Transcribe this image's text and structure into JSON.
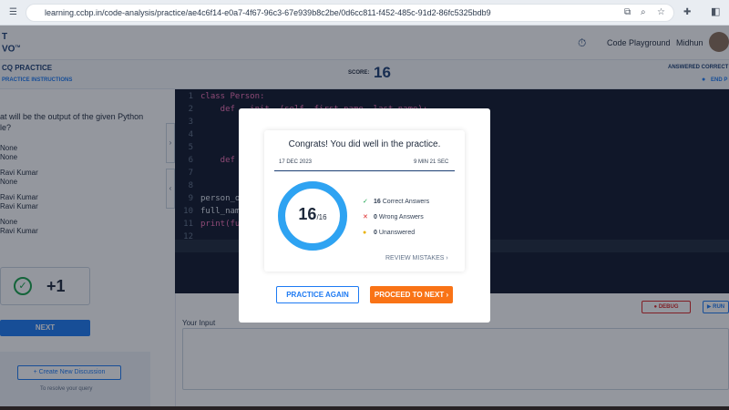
{
  "browser": {
    "url": "learning.ccbp.in/code-analysis/practice/ae4c6f14-e0a7-4f67-96c3-67e939b8c2be/0d6cc811-f452-485c-91d2-86fc5325bdb9"
  },
  "header": {
    "logo_line1": "T",
    "logo_line2": "VO",
    "logo_tm": "TM",
    "code_playground": "Code Playground",
    "user_name": "Midhun"
  },
  "subheader": {
    "title": "CQ PRACTICE",
    "instructions": "PRACTICE INSTRUCTIONS",
    "score_label": "SCORE:",
    "score_value": "16",
    "answered_label": "ANSWERED CORRECT",
    "end_label": "END P"
  },
  "question": {
    "text_line1": "at will be the output of the given Python",
    "text_line2": "le?",
    "options": [
      {
        "line1": "None",
        "line2": "None"
      },
      {
        "line1": "Ravi Kumar",
        "line2": "None"
      },
      {
        "line1": "Ravi Kumar",
        "line2": "Ravi Kumar"
      },
      {
        "line1": "None",
        "line2": "Ravi Kumar"
      }
    ],
    "result_points": "+1",
    "next_label": "NEXT",
    "discussion_label": "+ Create New Discussion",
    "discussion_hint": "To resolve your query"
  },
  "editor": {
    "lines": [
      {
        "num": "1",
        "text": "class Person:"
      },
      {
        "num": "2",
        "text": "    def __init__(self, first_name, last_name):"
      },
      {
        "num": "3",
        "text": "        s"
      },
      {
        "num": "4",
        "text": "        s"
      },
      {
        "num": "5",
        "text": ""
      },
      {
        "num": "6",
        "text": "    def f"
      },
      {
        "num": "7",
        "text": "        p"
      },
      {
        "num": "8",
        "text": ""
      },
      {
        "num": "9",
        "text": "person_ob"
      },
      {
        "num": "10",
        "text": "full_name"
      },
      {
        "num": "11",
        "text": "print(ful"
      },
      {
        "num": "12",
        "text": ""
      }
    ],
    "debug_label": "DEBUG",
    "run_label": "RUN",
    "input_label": "Your Input"
  },
  "modal": {
    "congrats": "Congrats! You did well in the practice.",
    "date": "17 DEC 2023",
    "duration": "9 MIN 21 SEC",
    "score": "16",
    "total": "/16",
    "stats": [
      {
        "count": "16",
        "label": "Correct Answers",
        "icon": "check-icon",
        "color": "#16a34a"
      },
      {
        "count": "0",
        "label": "Wrong Answers",
        "icon": "cross-icon",
        "color": "#dc2626"
      },
      {
        "count": "0",
        "label": "Unanswered",
        "icon": "dot-icon",
        "color": "#eab308"
      }
    ],
    "review": "REVIEW MISTAKES",
    "practice_again": "PRACTICE AGAIN",
    "proceed": "PROCEED TO NEXT"
  },
  "colors": {
    "accent": "#1d7af3",
    "navy": "#1c3f73",
    "orange": "#f97316",
    "ring": "#2ea3f2"
  }
}
